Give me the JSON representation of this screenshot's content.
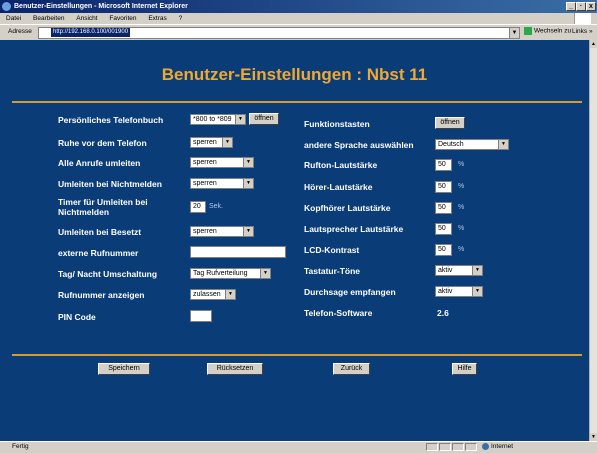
{
  "window": {
    "title": "Benutzer-Einstellungen - Microsoft Internet Explorer",
    "controls": [
      "_",
      "·",
      "x"
    ]
  },
  "menu": {
    "items": [
      "Datei",
      "Bearbeiten",
      "Ansicht",
      "Favoriten",
      "Extras",
      "?"
    ]
  },
  "address": {
    "label": "Adresse",
    "url": "http://192.168.0.100/001900",
    "go_label": "Wechseln zu",
    "links_label": "Links »"
  },
  "page": {
    "title": "Benutzer-Einstellungen  :  Nbst 11"
  },
  "left": {
    "phonebook": {
      "label": "Persönliches Telefonbuch",
      "value": "*800 to *809",
      "button": "öffnen"
    },
    "dnd": {
      "label": "Ruhe vor dem Telefon",
      "value": "sperren"
    },
    "forward_all": {
      "label": "Alle Anrufe umleiten",
      "value": "sperren"
    },
    "forward_noanswer": {
      "label": "Umleiten bei Nichtmelden",
      "value": "sperren"
    },
    "timer": {
      "label_line1": "Timer für Umleiten bei",
      "label_line2": "Nichtmelden",
      "value": "20",
      "unit": "Sek."
    },
    "forward_busy": {
      "label": "Umleiten bei Besetzt",
      "value": "sperren"
    },
    "external": {
      "label": "externe Rufnummer",
      "value": ""
    },
    "daynight": {
      "label": "Tag/ Nacht Umschaltung",
      "value": "Tag Rufverteilung"
    },
    "show_number": {
      "label": "Rufnummer anzeigen",
      "value": "zulassen"
    },
    "pin": {
      "label": "PIN Code",
      "value": ""
    }
  },
  "right": {
    "function_keys": {
      "label": "Funktionstasten",
      "button": "öffnen"
    },
    "language": {
      "label": "andere Sprache auswählen",
      "value": "Deutsch"
    },
    "ring_volume": {
      "label": "Rufton-Lautstärke",
      "value": "50",
      "unit": "%"
    },
    "handset_volume": {
      "label": "Hörer-Lautstärke",
      "value": "50",
      "unit": "%"
    },
    "headset_volume": {
      "label": "Kopfhörer Lautstärke",
      "value": "50",
      "unit": "%"
    },
    "speaker_volume": {
      "label": "Lautsprecher Lautstärke",
      "value": "50",
      "unit": "%"
    },
    "lcd_contrast": {
      "label": "LCD-Kontrast",
      "value": "50",
      "unit": "%"
    },
    "key_tones": {
      "label": "Tastatur-Töne",
      "value": "aktiv"
    },
    "announcement": {
      "label": "Durchsage empfangen",
      "value": "aktiv"
    },
    "software": {
      "label": "Telefon-Software",
      "value": "2.6"
    }
  },
  "buttons": {
    "save": "Speichern",
    "reset": "Rücksetzen",
    "back": "Zurück",
    "help": "Hilfe"
  },
  "status": {
    "text": "Fertig",
    "zone": "Internet"
  }
}
